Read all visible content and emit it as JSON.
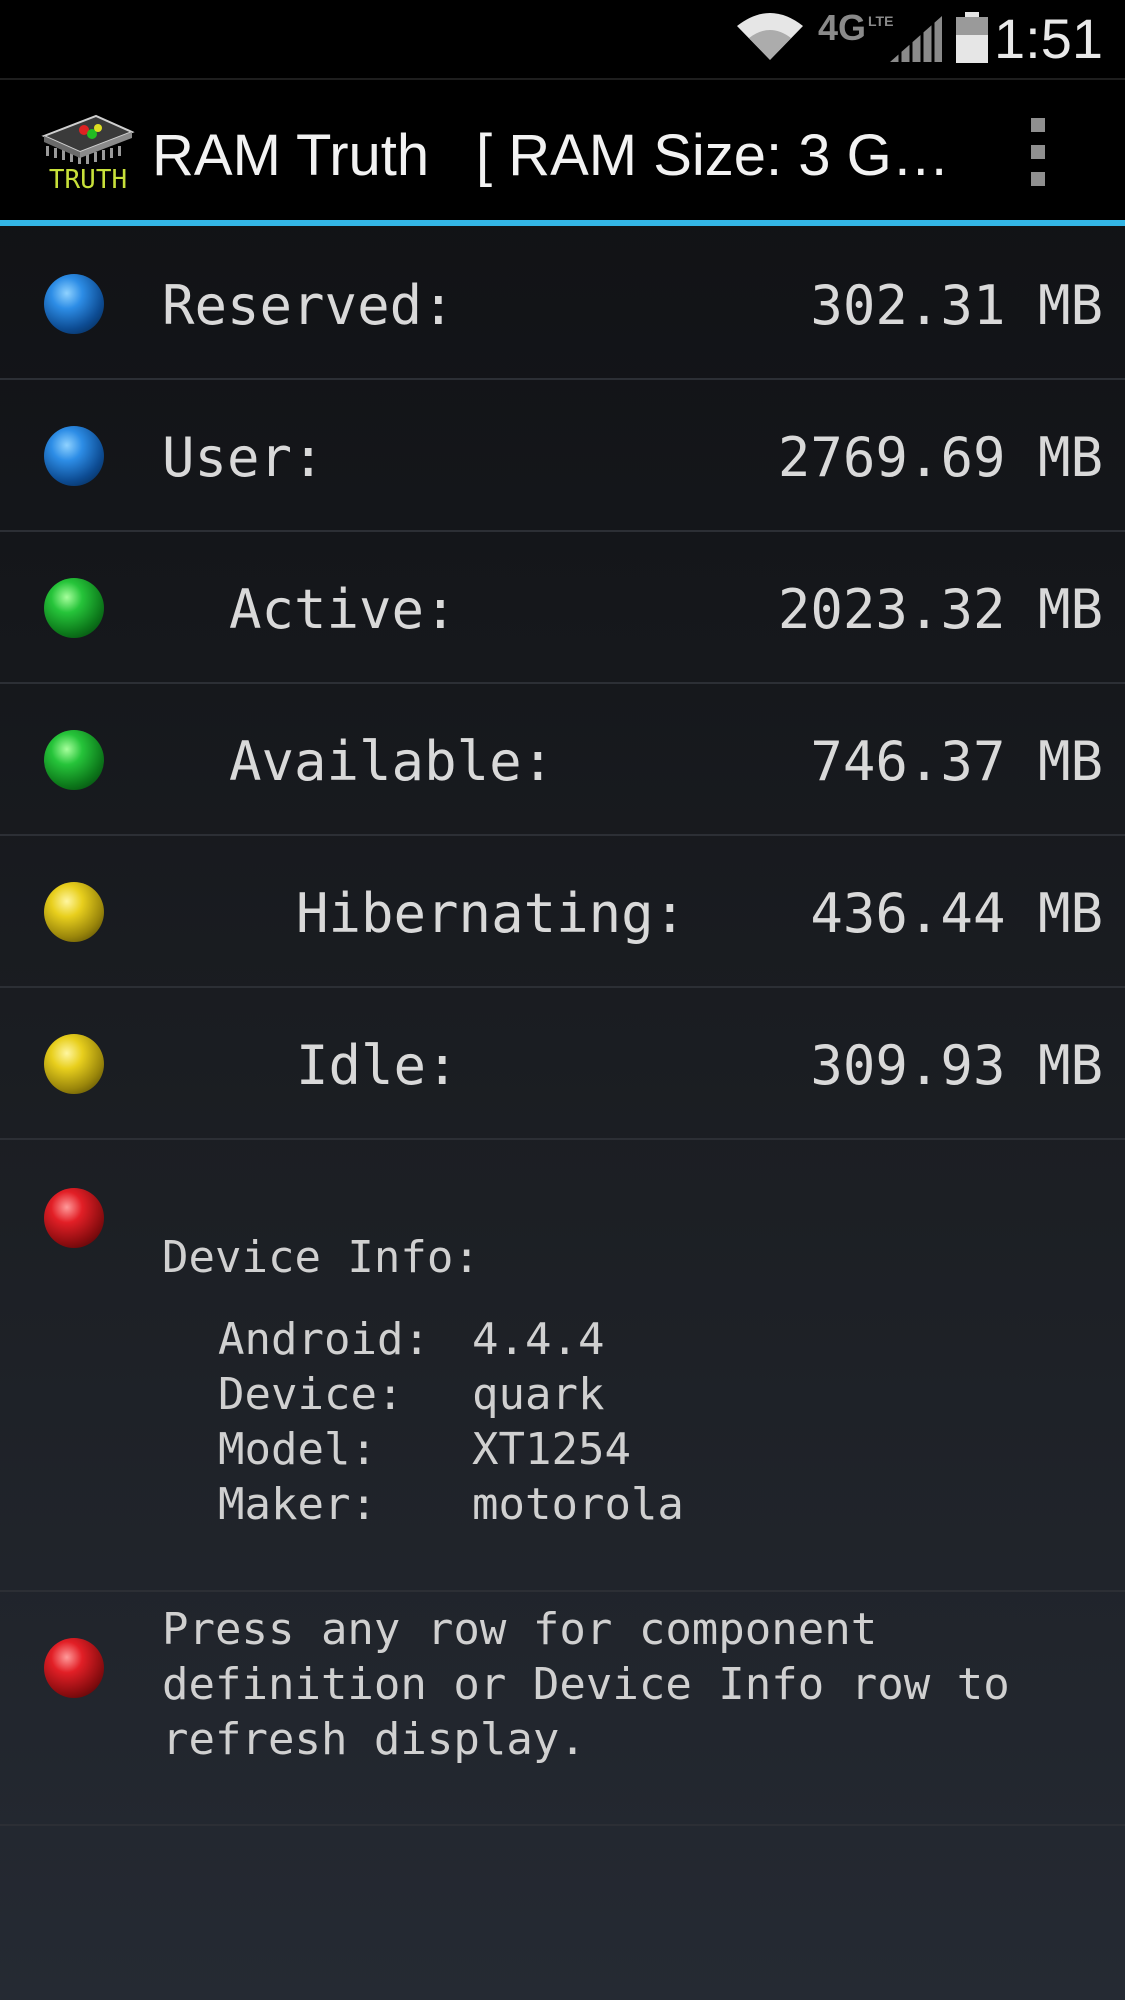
{
  "status_bar": {
    "time": "1:51",
    "network_label": "4G",
    "network_sublabel": "LTE",
    "icons": [
      "wifi-icon",
      "signal-icon",
      "battery-icon"
    ]
  },
  "action_bar": {
    "title": "RAM Truth",
    "subtitle": "[ RAM Size: 3 G…",
    "icon_text": "TRUTH",
    "overflow_icon": "overflow-menu-icon"
  },
  "rows": [
    {
      "label": "Reserved:",
      "value": "302.31 MB",
      "color": "blue"
    },
    {
      "label": "User:",
      "value": "2769.69 MB",
      "color": "blue"
    },
    {
      "label": "Active:",
      "value": "2023.32 MB",
      "color": "green"
    },
    {
      "label": "Available:",
      "value": "746.37 MB",
      "color": "green"
    },
    {
      "label": "Hibernating:",
      "value": "436.44 MB",
      "color": "yellow"
    },
    {
      "label": "Idle:",
      "value": "309.93 MB",
      "color": "yellow"
    }
  ],
  "device_info": {
    "title": "Device Info:",
    "lines": [
      {
        "key": "Android:",
        "value": "4.4.4"
      },
      {
        "key": "Device:",
        "value": "quark"
      },
      {
        "key": "Model:",
        "value": "XT1254"
      },
      {
        "key": "Maker:",
        "value": "motorola"
      }
    ]
  },
  "help_note": "Press any row for component definition or Device Info row to refresh display.",
  "colors": {
    "accent": "#33b5e5",
    "blue": "#2d8de6",
    "green": "#26c43a",
    "yellow": "#e8cf1d",
    "red": "#e21f26"
  }
}
